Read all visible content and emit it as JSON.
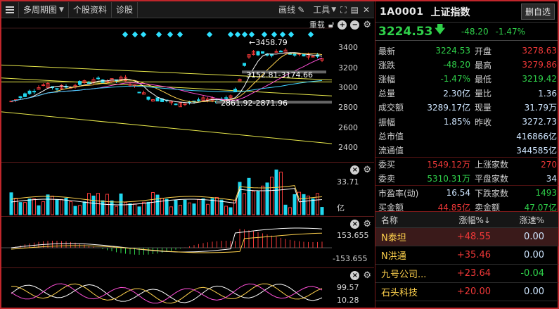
{
  "toolbar": {
    "period": "多周期图",
    "stock_info": "个股资料",
    "diagnosis": "诊股",
    "draw_line": "画线",
    "tools": "工具"
  },
  "main_pane": {
    "restore_label": "重载",
    "y_ticks": [
      "3400",
      "3200",
      "3000",
      "2800",
      "2600",
      "2400"
    ],
    "y_tick_values": [
      3400,
      3200,
      3000,
      2800,
      2600,
      2400
    ],
    "annotations": {
      "high": "←3458.79",
      "zone_upper": "3152.81-3174.66",
      "zone_lower": "2861.92-2871.96"
    }
  },
  "volume_pane": {
    "max_label": "33.71",
    "unit_label": "亿"
  },
  "macd_pane": {
    "upper_label": "153.655",
    "lower_label": "-153.655"
  },
  "kdj_pane": {
    "upper_label": "99.57",
    "lower_label": "10.28"
  },
  "quote": {
    "code": "1A0001",
    "name": "上证指数",
    "fav_button": "删自选",
    "last": "3224.53",
    "change": "-48.20",
    "change_pct": "-1.47%",
    "rows": [
      {
        "l1": "最新",
        "v1": "3224.53",
        "c1": "g",
        "l2": "开盘",
        "v2": "3278.63",
        "c2": "r"
      },
      {
        "l1": "涨跌",
        "v1": "-48.20",
        "c1": "g",
        "l2": "最高",
        "v2": "3279.86",
        "c2": "r"
      },
      {
        "l1": "涨幅",
        "v1": "-1.47%",
        "c1": "g",
        "l2": "最低",
        "v2": "3219.42",
        "c2": "g"
      },
      {
        "l1": "总量",
        "v1": "2.30亿",
        "c1": "w",
        "l2": "量比",
        "v2": "1.36",
        "c2": "w"
      },
      {
        "l1": "成交额",
        "v1": "3289.17亿",
        "c1": "w",
        "l2": "现量",
        "v2": "31.79万",
        "c2": "w"
      },
      {
        "l1": "振幅",
        "v1": "1.85%",
        "c1": "w",
        "l2": "昨收",
        "v2": "3272.73",
        "c2": "w"
      },
      {
        "l1": "总市值",
        "v1": "",
        "c1": "w",
        "l2": "",
        "v2": "416866亿",
        "c2": "w"
      },
      {
        "l1": "流通值",
        "v1": "",
        "c1": "w",
        "l2": "",
        "v2": "344585亿",
        "c2": "w"
      },
      {
        "l1": "委买",
        "v1": "1549.12万",
        "c1": "r",
        "l2": "上涨家数",
        "v2": "270",
        "c2": "r"
      },
      {
        "l1": "委卖",
        "v1": "5310.31万",
        "c1": "g",
        "l2": "平盘家数",
        "v2": "34",
        "c2": "w"
      },
      {
        "l1": "市盈率(动)",
        "v1": "16.54",
        "c1": "w",
        "l2": "下跌家数",
        "v2": "1493",
        "c2": "g"
      },
      {
        "l1": "买金额",
        "v1": "44.85亿",
        "c1": "r",
        "l2": "卖金额",
        "v2": "47.07亿",
        "c2": "g"
      }
    ]
  },
  "stock_list": {
    "headers": {
      "name": "名称",
      "pct": "涨幅%↓",
      "speed": "涨速%"
    },
    "rows": [
      {
        "name": "N泰坦",
        "pct": "+48.55",
        "speed": "0.00",
        "speed_color": "w"
      },
      {
        "name": "N洪通",
        "pct": "+35.46",
        "speed": "0.00",
        "speed_color": "w"
      },
      {
        "name": "九号公司...",
        "pct": "+23.64",
        "speed": "-0.04",
        "speed_color": "g"
      },
      {
        "name": "石头科技",
        "pct": "+20.00",
        "speed": "0.00",
        "speed_color": "w"
      }
    ]
  },
  "colors": {
    "up": "#f03838",
    "down": "#2fd14a",
    "cyan_bar": "#20d8ef",
    "frame": "#c0262b",
    "line_yellow": "#e6e64a"
  }
}
